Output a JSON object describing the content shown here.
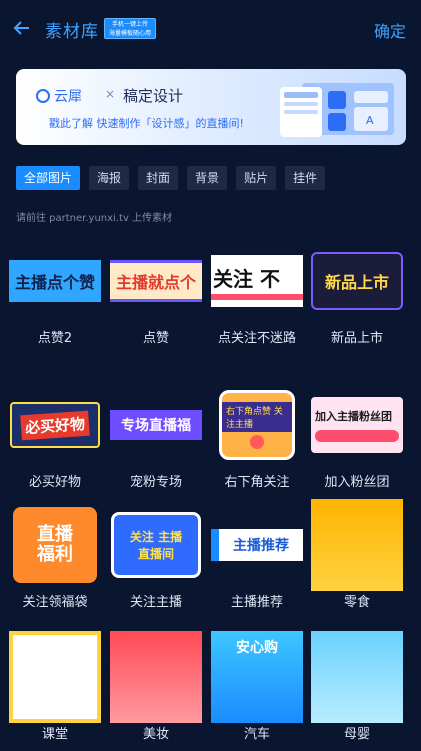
{
  "header": {
    "title": "素材库",
    "tag_line1": "手机一键上传",
    "tag_line2": "海量模板随心用",
    "confirm_label": "确定"
  },
  "banner": {
    "logo_text": "云犀",
    "separator": "×",
    "brand": "稿定设计",
    "description": "戳此了解 快速制作「设计感」的直播间!"
  },
  "tabs": [
    "全部图片",
    "海报",
    "封面",
    "背景",
    "贴片",
    "挂件"
  ],
  "hint": "请前往 partner.yunxi.tv 上传素材",
  "items": [
    {
      "label": "点赞2",
      "art": "主播点个赞"
    },
    {
      "label": "点赞",
      "art": "主播就点个"
    },
    {
      "label": "点关注不迷路",
      "art": "关注 不"
    },
    {
      "label": "新品上市",
      "art": "新品上市"
    },
    {
      "label": "必买好物",
      "art": "必买好物"
    },
    {
      "label": "宠粉专场",
      "art": "专场直播福"
    },
    {
      "label": "右下角关注",
      "art": "右下角点赞 关注主播"
    },
    {
      "label": "加入粉丝团",
      "art": "加入主播粉丝团"
    },
    {
      "label": "关注领福袋",
      "art": "直播福利"
    },
    {
      "label": "关注主播",
      "art": "关注 主播直播间"
    },
    {
      "label": "主播推荐",
      "art": "主播推荐"
    },
    {
      "label": "零食",
      "art": ""
    },
    {
      "label": "课堂",
      "art": ""
    },
    {
      "label": "美妆",
      "art": ""
    },
    {
      "label": "汽车",
      "art": "安心购"
    },
    {
      "label": "母婴",
      "art": ""
    }
  ],
  "colors": {
    "background": "#0a1530",
    "accent": "#1a8cff",
    "title": "#3ea1ff"
  }
}
